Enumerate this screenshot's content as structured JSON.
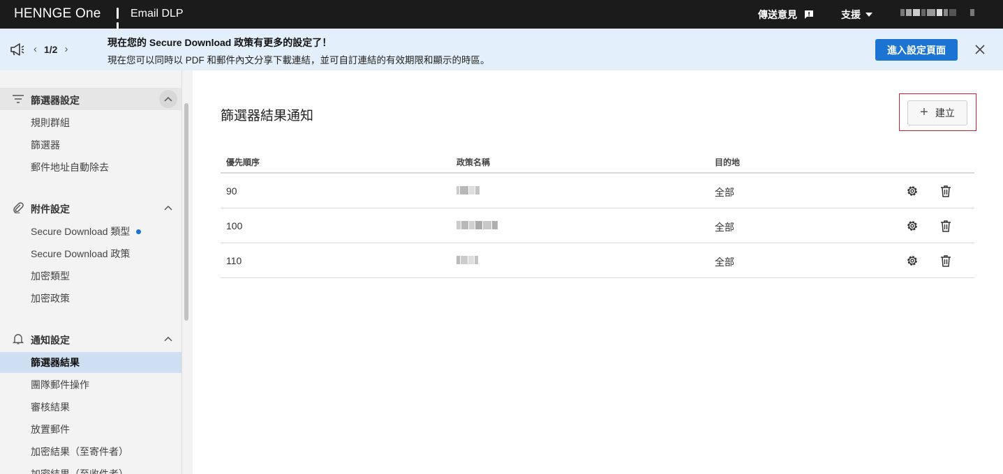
{
  "topbar": {
    "brand": "HENNGE One",
    "app": "Email DLP",
    "feedback": "傳送意見",
    "support": "支援"
  },
  "banner": {
    "page": "1/2",
    "title": "現在您的 Secure Download 政策有更多的設定了！",
    "text": "現在您可以同時以 PDF 和郵件內文分享下載連結，並可自訂連結的有效期限和顯示的時區。",
    "action": "進入設定頁面"
  },
  "sidebar": {
    "sections": [
      {
        "label": "篩選器設定",
        "icon": "filter-icon",
        "items": [
          "規則群組",
          "篩選器",
          "郵件地址自動除去"
        ]
      },
      {
        "label": "附件設定",
        "icon": "paperclip-icon",
        "items": [
          "Secure Download 類型",
          "Secure Download 政策",
          "加密類型",
          "加密政策"
        ]
      },
      {
        "label": "通知設定",
        "icon": "bell-icon",
        "items": [
          "篩選器結果",
          "團隊郵件操作",
          "審核結果",
          "放置郵件",
          "加密結果（至寄件者）",
          "加密結果（至收件者）"
        ]
      }
    ],
    "selected": "篩選器結果"
  },
  "main": {
    "title": "篩選器結果通知",
    "create": "建立",
    "columns": {
      "priority": "優先順序",
      "policy_name": "政策名稱",
      "destination": "目的地"
    },
    "rows": [
      {
        "priority": "90",
        "destination": "全部"
      },
      {
        "priority": "100",
        "destination": "全部"
      },
      {
        "priority": "110",
        "destination": "全部"
      }
    ]
  },
  "colors": {
    "topbar": "#1b1b1b",
    "banner": "#e3f0fb",
    "primary": "#1b74d2",
    "selected": "#cddff0",
    "highlight": "#c8202e"
  }
}
